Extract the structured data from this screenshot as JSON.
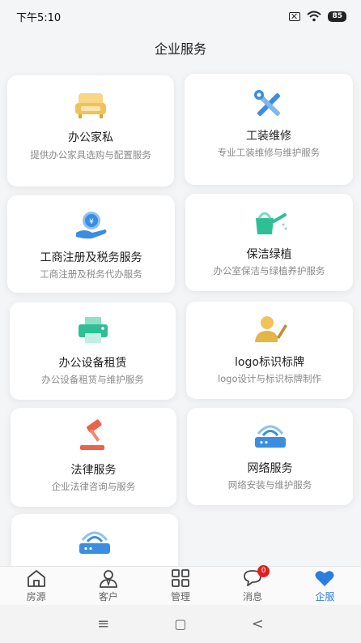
{
  "status": {
    "time": "下午5:10",
    "battery": "85"
  },
  "header": {
    "title": "企业服务"
  },
  "cards": [
    {
      "title": "办公家私",
      "desc": "提供办公家具选购与配置服务",
      "icon": "office-furniture-icon",
      "color": "#f0c25a"
    },
    {
      "title": "工装维修",
      "desc": "专业工装维修与维护服务",
      "icon": "wrench-screwdriver-icon",
      "color": "#3b8de0"
    },
    {
      "title": "工商注册及税务服务",
      "desc": "工商注册及税务代办服务",
      "icon": "tax-hand-coin-icon",
      "color": "#3b8de0"
    },
    {
      "title": "保洁绿植",
      "desc": "办公室保洁与绿植养护服务",
      "icon": "watering-can-icon",
      "color": "#2fbf96"
    },
    {
      "title": "办公设备租赁",
      "desc": "办公设备租赁与维护服务",
      "icon": "printer-icon",
      "color": "#2fbf96"
    },
    {
      "title": "logo标识标牌",
      "desc": "logo设计与标识标牌制作",
      "icon": "designer-pen-icon",
      "color": "#e3b54a"
    },
    {
      "title": "法律服务",
      "desc": "企业法律咨询与服务",
      "icon": "gavel-icon",
      "color": "#e8644a"
    },
    {
      "title": "网络服务",
      "desc": "网络安装与维护服务",
      "icon": "router-icon",
      "color": "#3b8de0"
    },
    {
      "title": "",
      "desc": "",
      "icon": "router-icon",
      "color": "#3b8de0"
    }
  ],
  "nav": [
    {
      "label": "房源",
      "icon": "house-icon"
    },
    {
      "label": "客户",
      "icon": "person-icon"
    },
    {
      "label": "管理",
      "icon": "grid-icon"
    },
    {
      "label": "消息",
      "icon": "chat-bubble-icon",
      "badge": "0"
    },
    {
      "label": "企服",
      "icon": "heart-icon",
      "active": true
    }
  ],
  "system_nav": {
    "menu": "≡",
    "home": "▢",
    "back": "<"
  }
}
